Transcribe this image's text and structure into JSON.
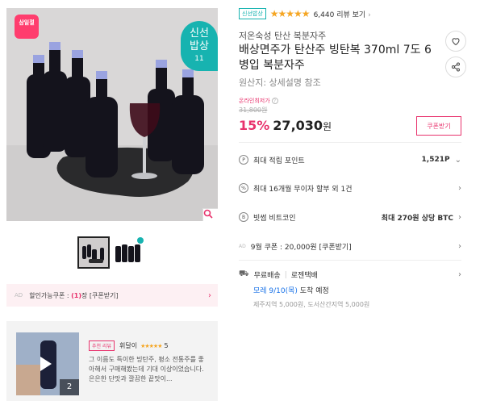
{
  "hero": {
    "sale_badge": "삼일절",
    "fresh_badge": {
      "line1": "신선",
      "line2": "밥상",
      "line3": "11"
    },
    "zoom_icon": "magnifier-icon"
  },
  "thumbnails": [
    {
      "label": "product-photo"
    },
    {
      "label": "bottles-photo"
    }
  ],
  "coupon_bar": {
    "ad": "AD",
    "text_prefix": "할인가능쿠폰 : ",
    "count": "(1)",
    "text_suffix": "장 [쿠폰받기]",
    "chevron": "›"
  },
  "review": {
    "tag": "추천 리뷰",
    "user": "휘달이",
    "stars": "★★★★★",
    "score": "5",
    "text": "그 이름도 특이한 빙탄주, 평소 전통주를 좋아해서 구매해봤는데 기대 이상이었습니다. 은은한 단맛과 깔끔한 끝맛이...",
    "media_count": "2"
  },
  "product": {
    "fresh_tag": "신선밥상",
    "stars": "★★★★★",
    "review_link": "6,440 리뷰 보기",
    "brand": "저온숙성 탄산 복분자주",
    "title": "배상면주가 탄산주 빙탄복 370ml 7도 6병입 복분자주",
    "origin": "원산지:  상세설명 참조",
    "lowest_label": "온라인최저가",
    "original_price": "31,800원",
    "discount": "15%",
    "price": "27,030",
    "won": "원",
    "coupon_button": "쿠폰받기"
  },
  "info_rows": [
    {
      "icon": "P",
      "label": "최대 적립 포인트",
      "value": "1,521P",
      "chevron": "⌄"
    },
    {
      "icon": "%",
      "label": "최대 16개월 무이자 할부 외 1건",
      "value": "",
      "chevron": "›"
    },
    {
      "icon": "B",
      "label": "빗썸 비트코인",
      "value": "최대 270원 상당 BTC",
      "chevron": "›"
    },
    {
      "icon": "AD",
      "label": "9월 쿠폰 : 20,000원 [쿠폰받기]",
      "value": "",
      "chevron": "›"
    }
  ],
  "shipping": {
    "label": "무료배송",
    "carrier": "로젠택배",
    "date": "모레 9/10(목)",
    "date_suffix": " 도착 예정",
    "note": "제주지역 5,000원, 도서산간지역 5,000원",
    "chevron": "›"
  }
}
